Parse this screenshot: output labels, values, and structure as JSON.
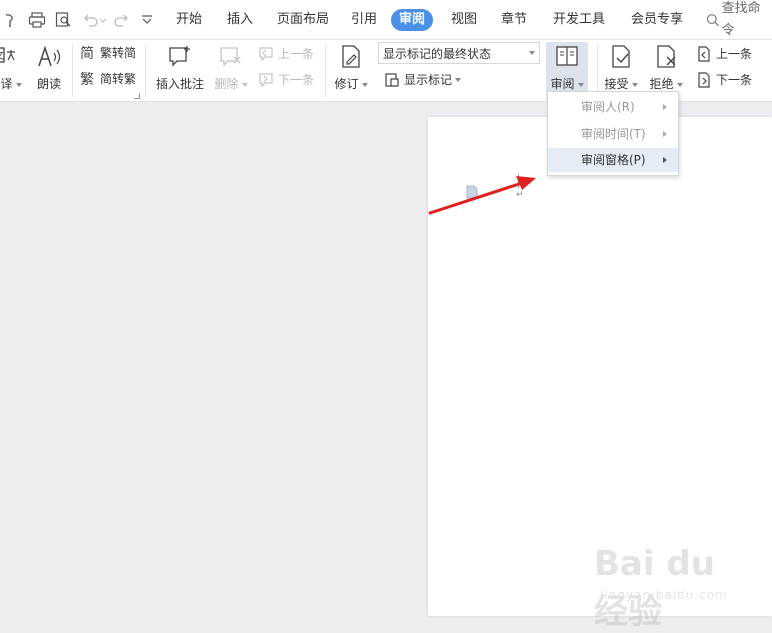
{
  "tabs": [
    {
      "label": "开始",
      "active": false
    },
    {
      "label": "插入",
      "active": false
    },
    {
      "label": "页面布局",
      "active": false
    },
    {
      "label": "引用",
      "active": false
    },
    {
      "label": "审阅",
      "active": true
    },
    {
      "label": "视图",
      "active": false
    },
    {
      "label": "章节",
      "active": false
    },
    {
      "label": "开发工具",
      "active": false
    },
    {
      "label": "会员专享",
      "active": false
    }
  ],
  "search": {
    "label": "查找命令"
  },
  "ribbon": {
    "translate_label": "翻译",
    "read_aloud_label": "朗读",
    "trad_to_simp_label": "繁转简",
    "simp_to_trad_label": "简转繁",
    "insert_comment_label": "插入批注",
    "delete_label": "删除",
    "prev_comment_label": "上一条",
    "next_comment_label": "下一条",
    "track_changes_label": "修订",
    "display_mode_value": "显示标记的最终状态",
    "show_markup_label": "显示标记",
    "review_label": "审阅",
    "accept_label": "接受",
    "reject_label": "拒绝",
    "prev_change_label": "上一条",
    "next_change_label": "下一条"
  },
  "review_menu": {
    "items": [
      {
        "label": "审阅人(R)",
        "enabled": false
      },
      {
        "label": "审阅时间(T)",
        "enabled": false
      },
      {
        "label": "审阅窗格(P)",
        "enabled": true
      }
    ]
  },
  "document": {
    "paragraph_mark": "↵"
  },
  "watermark": {
    "brand": "Bai du 经验",
    "url": "jingyan.baidu.com"
  },
  "colors": {
    "accent": "#4a90e8",
    "annotation_arrow": "#e02020"
  }
}
